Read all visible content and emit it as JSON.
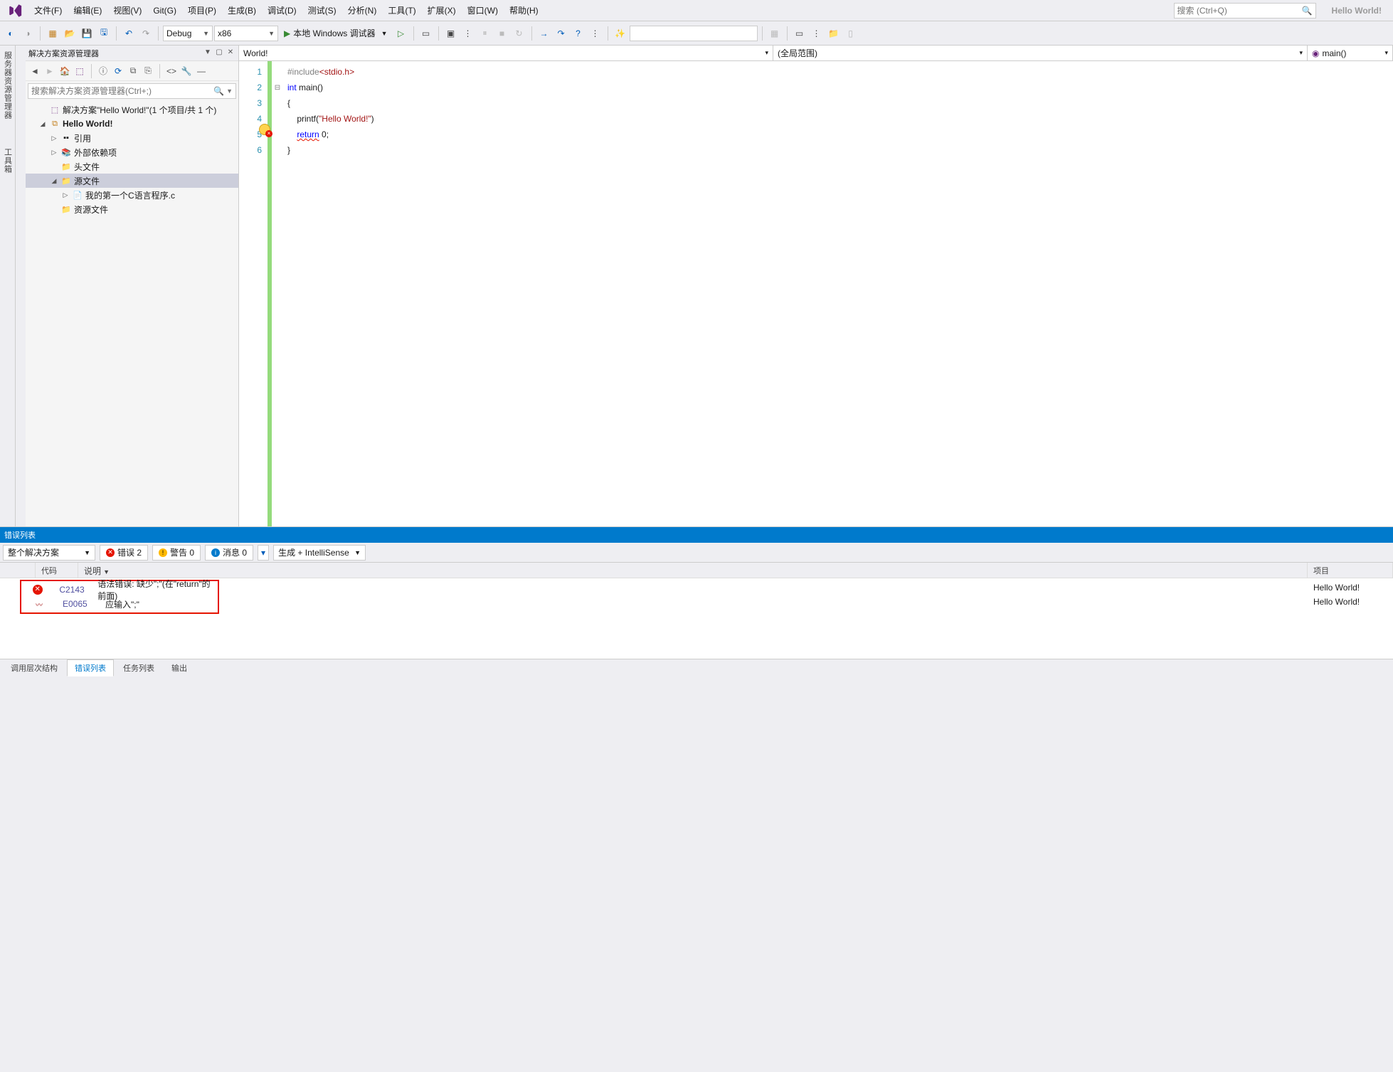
{
  "menu": {
    "file": "文件(F)",
    "edit": "编辑(E)",
    "view": "视图(V)",
    "git": "Git(G)",
    "project": "项目(P)",
    "build": "生成(B)",
    "debug": "调试(D)",
    "test": "测试(S)",
    "analyze": "分析(N)",
    "tools": "工具(T)",
    "extensions": "扩展(X)",
    "window": "窗口(W)",
    "help": "帮助(H)"
  },
  "search": {
    "placeholder": "搜索 (Ctrl+Q)"
  },
  "solution_name": "Hello World!",
  "toolbar": {
    "config": "Debug",
    "platform": "x86",
    "debugger": "本地 Windows 调试器"
  },
  "solution_explorer": {
    "title": "解决方案资源管理器",
    "search_placeholder": "搜索解决方案资源管理器(Ctrl+;)",
    "root": "解决方案\"Hello World!\"(1 个项目/共 1 个)",
    "project": "Hello World!",
    "refs": "引用",
    "ext_deps": "外部依赖项",
    "headers": "头文件",
    "sources": "源文件",
    "myfile": "我的第一个C语言程序.c",
    "resources": "资源文件"
  },
  "nav": {
    "left": "World!",
    "middle": "(全局范围)",
    "right": "main()"
  },
  "code": {
    "l1_inc": "#include",
    "l1_hdr": "<stdio.h>",
    "l2_a": "int",
    "l2_b": " main()",
    "l3": "{",
    "l4_a": "    printf",
    "l4_b": "(",
    "l4_c": "\"Hello World!\"",
    "l4_d": ")",
    "l5_a": "    ",
    "l5_b": "return",
    "l5_c": " 0;",
    "l6": "}"
  },
  "errorlist": {
    "title": "错误列表",
    "scope": "整个解决方案",
    "errors": "错误 2",
    "warnings": "警告 0",
    "messages": "消息 0",
    "filter": "生成 + IntelliSense",
    "head_code": "代码",
    "head_desc": "说明",
    "head_proj": "项目",
    "rows": [
      {
        "icon": "err",
        "code": "C2143",
        "desc": "语法错误: 缺少\";\"(在\"return\"的前面)",
        "proj": "Hello World!"
      },
      {
        "icon": "wav",
        "code": "E0065",
        "desc": "应输入\";\"",
        "proj": "Hello World!"
      }
    ]
  },
  "bottom_tabs": {
    "t1": "调用层次结构",
    "t2": "错误列表",
    "t3": "任务列表",
    "t4": "输出"
  }
}
